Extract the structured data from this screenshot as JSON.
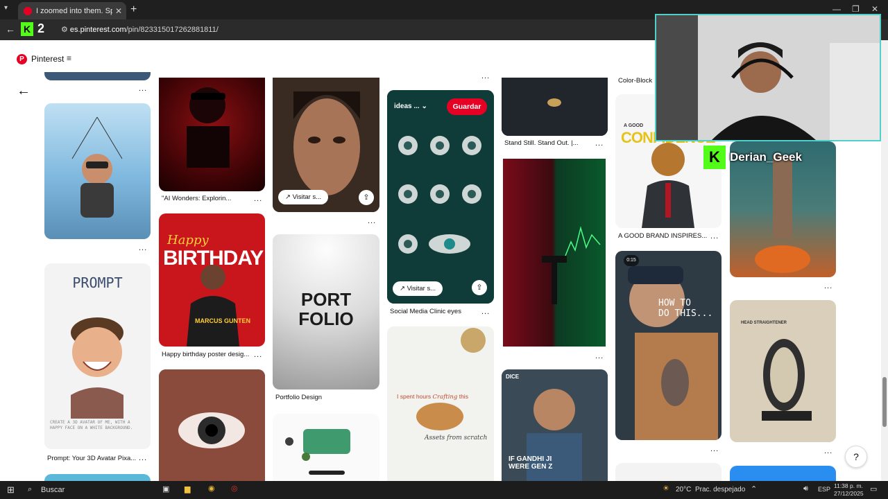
{
  "browser": {
    "tab_title": "I zoomed into them. Spent hou",
    "url_host": "es.pinterest.com",
    "url_path": "/pin/823315017262881811/",
    "kick_number": "2"
  },
  "pinterest": {
    "brand": "Pinterest",
    "menu_icon": "≡",
    "back_icon": "arrow-left-icon"
  },
  "pins": {
    "skydiver_caption": "",
    "ai_wonders": "\"AI Wonders: Explorin...",
    "birthday": "Happy birthday poster desig...",
    "birthday_title": "BIRTHDAY",
    "birthday_name": "MARCUS GUNTEN",
    "birthday_script": "Happy",
    "portfolio": "Portfolio Design",
    "portfolio_art": "PORT FOLIO",
    "social_eyes": "Social Media Clinic eyes",
    "stand_still": "Stand Still. Stand Out. |...",
    "color_block": "Color-Block",
    "good_brand": "A GOOD BRAND INSPIRES...",
    "good_brand_art": "CONFIDENCE",
    "good_brand_small": "A GOOD",
    "avatar_prompt_title": "PROMPT",
    "avatar_caption": "Prompt: Your 3D Avatar Pixa...",
    "avatar_body": "CREATE A 3D AVATAR OF ME, WITH A HAPPY FACE ON A WHITE BACKGROUND.",
    "howto_line1": "HOW TO",
    "howto_line2": "DO THIS...",
    "howto_badge": "0:15",
    "brain_text1": "I spent hours ",
    "brain_script": "Crafting",
    "brain_text2": " this",
    "brain_sub": "Assets from scratch",
    "gandhi_tag": "DICE",
    "gandhi_text": "IF GANDHI JI WERE GEN Z",
    "head_straightener": "HEAD STRAIGHTENER",
    "visit_label": "Visitar s...",
    "save_label": "Guardar",
    "board_label": "ideas ...",
    "more": "..."
  },
  "stream": {
    "streamer": "Derian_Geek",
    "kick_letter": "K"
  },
  "taskbar": {
    "search": "Buscar",
    "weather_temp": "20°C",
    "weather_text": "Prac. despejado",
    "lang": "ESP",
    "time": "11:38 p. m.",
    "date": "27/12/2025"
  },
  "colors": {
    "pinterest_red": "#e60023",
    "kick_green": "#53fc18",
    "cam_border": "#4fd0c8"
  }
}
